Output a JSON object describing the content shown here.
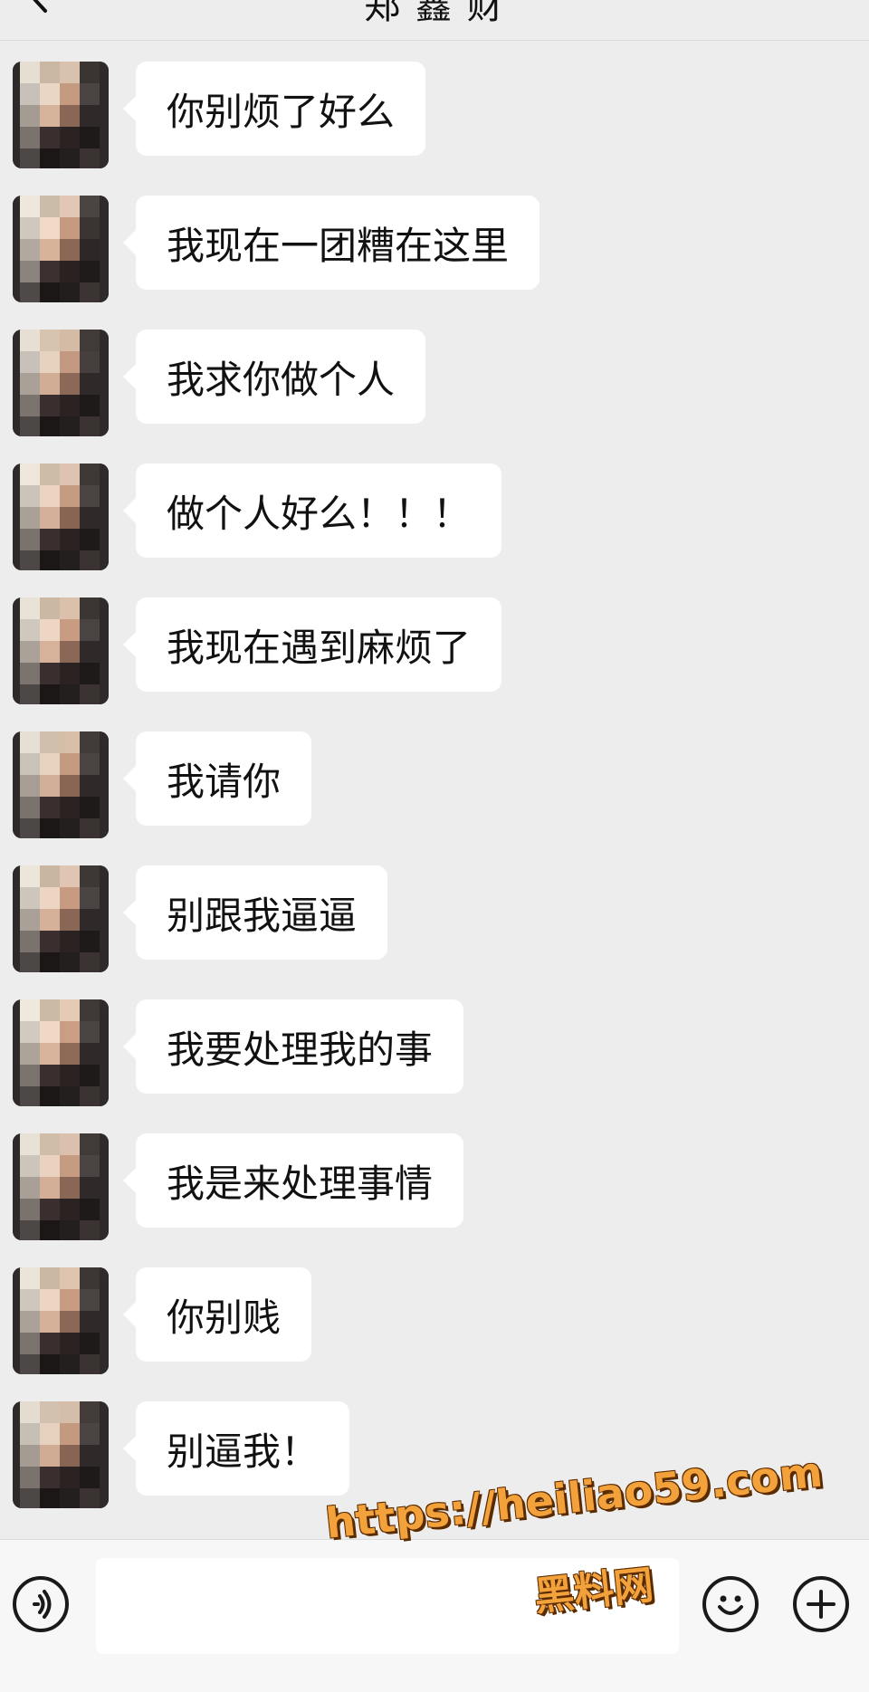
{
  "header": {
    "title": "郑 鑫 财"
  },
  "messages": [
    {
      "text": "你别烦了好么"
    },
    {
      "text": "我现在一团糟在这里"
    },
    {
      "text": "我求你做个人"
    },
    {
      "text": "做个人好么！！！"
    },
    {
      "text": "我现在遇到麻烦了"
    },
    {
      "text": "我请你"
    },
    {
      "text": "别跟我逼逼"
    },
    {
      "text": "我要处理我的事"
    },
    {
      "text": "我是来处理事情"
    },
    {
      "text": "你别贱"
    },
    {
      "text": "别逼我！"
    }
  ],
  "input": {
    "value": ""
  },
  "watermark": {
    "url": "https://heiliao59.com",
    "name": "黑料网"
  },
  "colors": {
    "background": "#ededed",
    "bubble": "#ffffff",
    "watermark": "#f2a13b"
  },
  "icons": {
    "back": "chevron-left-icon",
    "voice": "voice-icon",
    "emoji": "emoji-icon",
    "plus": "plus-icon"
  }
}
